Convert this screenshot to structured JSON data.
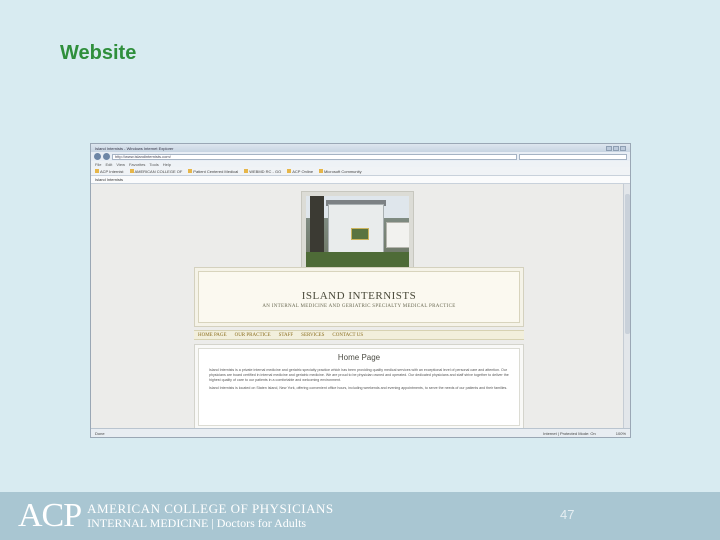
{
  "slide": {
    "title": "Website",
    "page_number": "47"
  },
  "browser": {
    "window_title": "Island Internists - Windows Internet Explorer",
    "url": "http://www.islandinternists.com/",
    "menu_items": [
      "File",
      "Edit",
      "View",
      "Favorites",
      "Tools",
      "Help"
    ],
    "favorites": [
      "ACP Internist",
      "AMERICAN COLLEGE OF",
      "Patient Centered Medical",
      "WEBMD RC - GO",
      "ACP Online",
      "Microsoft Community"
    ],
    "tab_label": "Island Internists",
    "status_text": "Done",
    "zone_text": "Internet | Protected Mode: On",
    "zoom": "100%"
  },
  "website": {
    "site_name": "ISLAND INTERNISTS",
    "tagline": "AN INTERNAL MEDICINE AND GERIATRIC SPECIALTY MEDICAL PRACTICE",
    "nav": [
      "HOME PAGE",
      "OUR PRACTICE",
      "STAFF",
      "SERVICES",
      "CONTACT US"
    ],
    "page_heading": "Home Page",
    "paragraphs": [
      "Island Internists is a private internal medicine and geriatric specialty practice which has been providing quality medical services with an exceptional level of personal care and attention. Our physicians are board certified in internal medicine and geriatric medicine. We are proud to be physician owned and operated. Our dedicated physicians and staff strive together to deliver the highest quality of care to our patients in a comfortable and welcoming environment.",
      "Island Internists is located on Staten Island, New York, offering convenient office hours, including weekends and evening appointments, to serve the needs of our patients and their families."
    ]
  },
  "footer": {
    "logo_mark": "ACP",
    "org_line1": "AMERICAN COLLEGE OF PHYSICIANS",
    "org_line2": "INTERNAL MEDICINE | Doctors for Adults"
  },
  "colors": {
    "slide_background": "#d8ebf1",
    "title_green": "#2f8f3c",
    "footer_band": "#a9c6d2",
    "nav_gold": "#8a6d1e"
  }
}
